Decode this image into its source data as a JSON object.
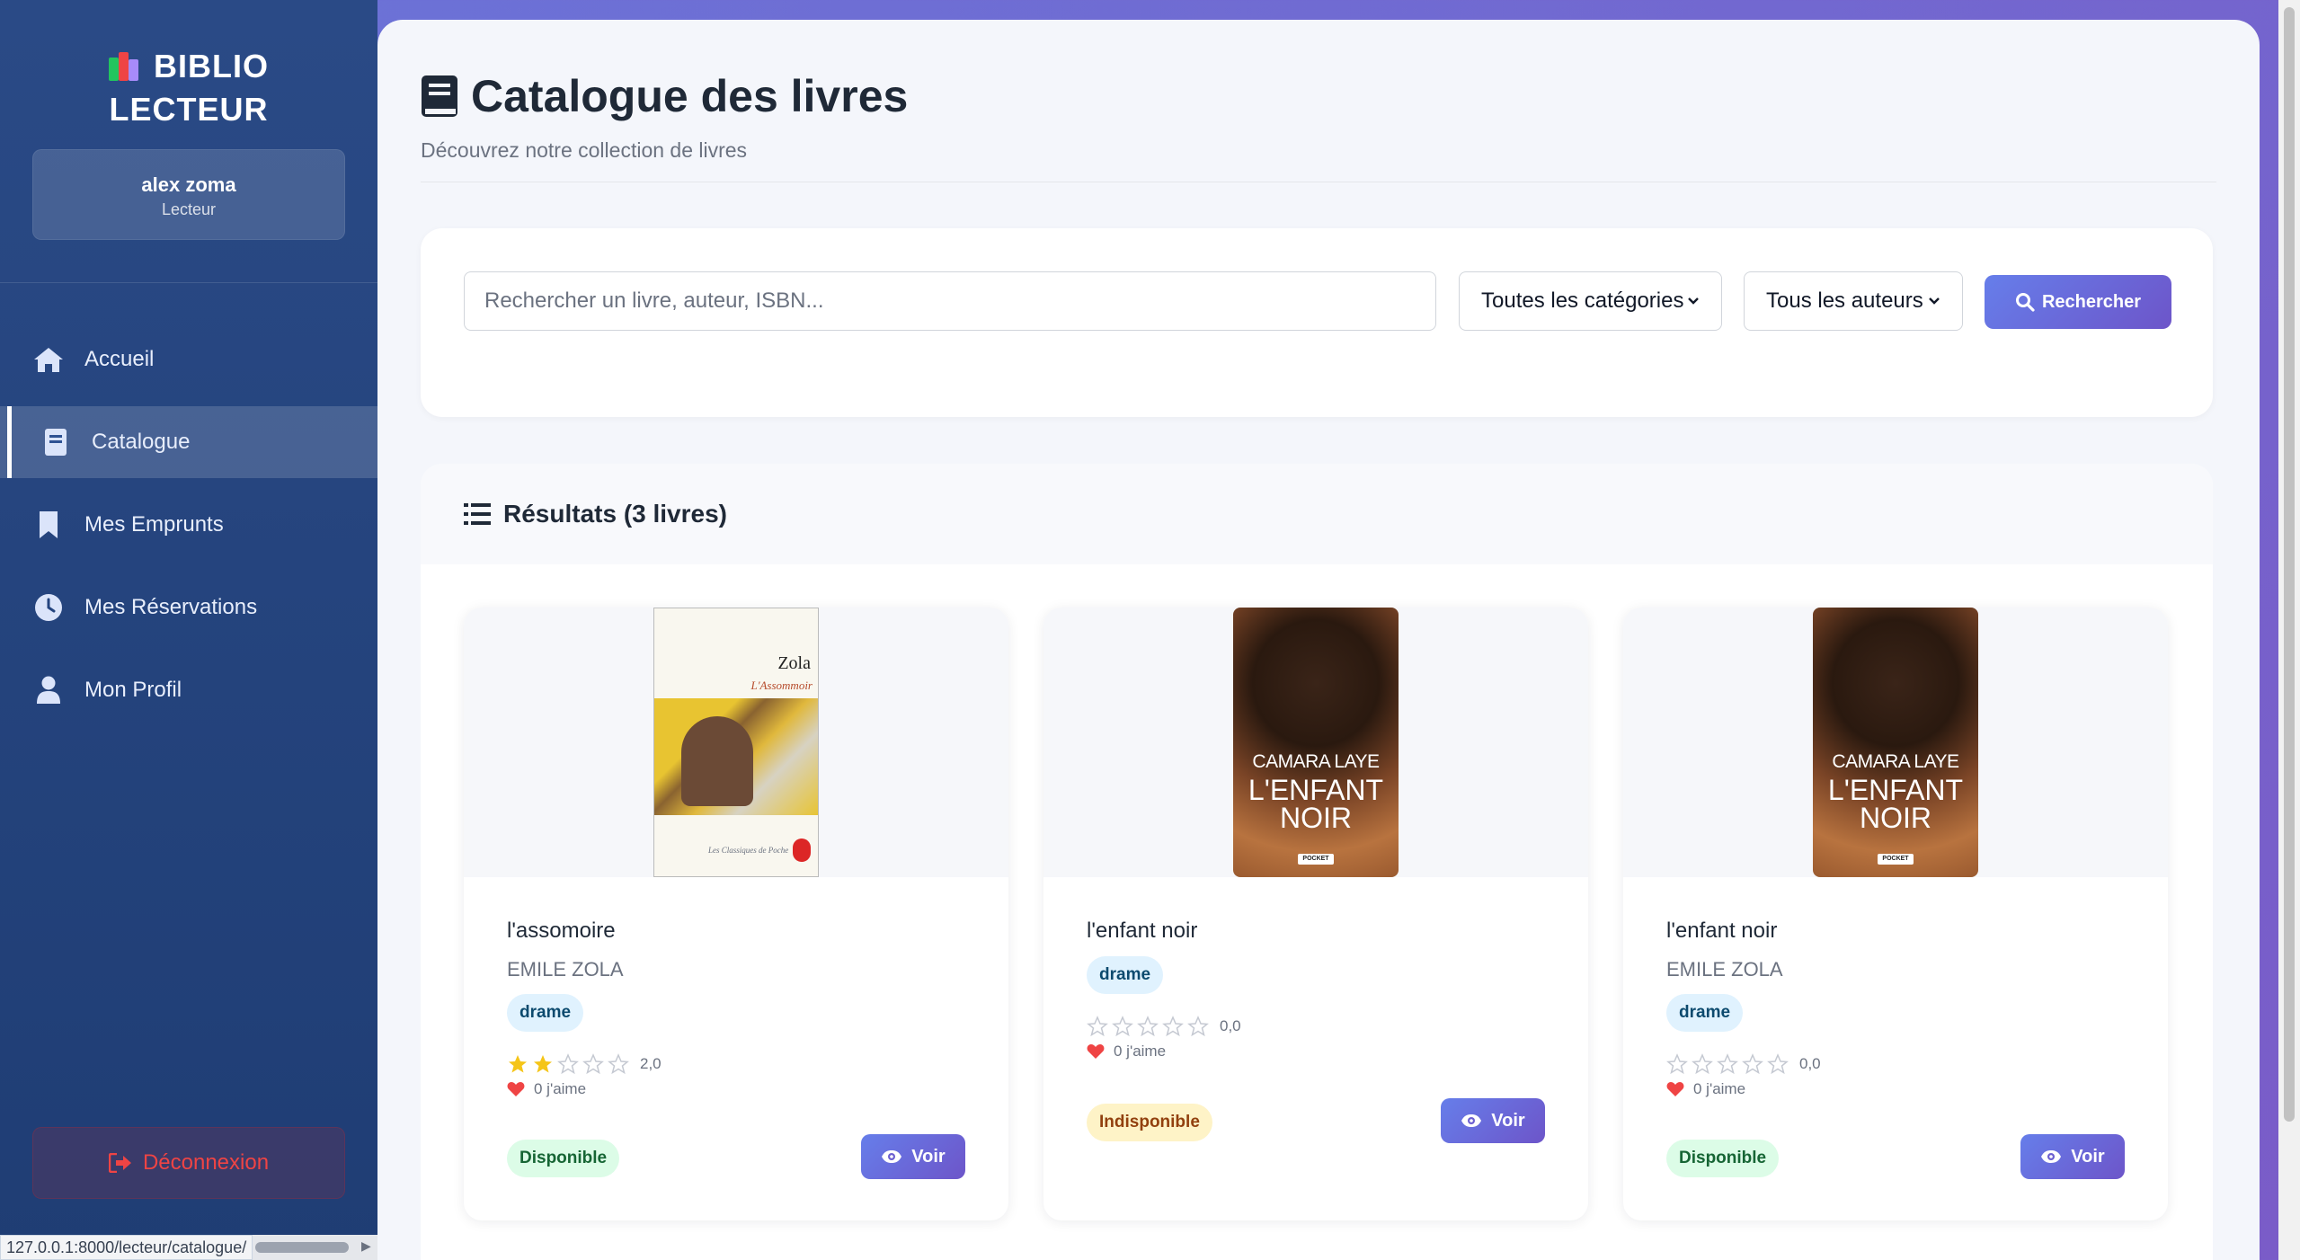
{
  "brand": {
    "line1": "BIBLIO",
    "line2": "LECTEUR"
  },
  "user": {
    "name": "alex zoma",
    "role": "Lecteur"
  },
  "nav": [
    {
      "label": "Accueil",
      "icon": "home-icon",
      "active": false
    },
    {
      "label": "Catalogue",
      "icon": "book-icon",
      "active": true
    },
    {
      "label": "Mes Emprunts",
      "icon": "bookmark-icon",
      "active": false
    },
    {
      "label": "Mes Réservations",
      "icon": "clock-icon",
      "active": false
    },
    {
      "label": "Mon Profil",
      "icon": "user-icon",
      "active": false
    }
  ],
  "logout": {
    "label": "Déconnexion"
  },
  "status_url": "127.0.0.1:8000/lecteur/catalogue/",
  "page": {
    "title": "Catalogue des livres",
    "subtitle": "Découvrez notre collection de livres"
  },
  "search": {
    "placeholder": "Rechercher un livre, auteur, ISBN...",
    "category_selected": "Toutes les catégories",
    "author_selected": "Tous les auteurs",
    "button": "Rechercher"
  },
  "results": {
    "header": "Résultats (3 livres)",
    "books": [
      {
        "title": "l'assomoire",
        "author": "EMILE ZOLA",
        "tag": "drame",
        "rating": 2,
        "rating_label": "2,0",
        "likes": "0 j'aime",
        "status": "Disponible",
        "available": true,
        "cover": {
          "author": "Zola",
          "title": "L'Assommoir",
          "footer": "Les Classiques de Poche"
        },
        "action": "Voir"
      },
      {
        "title": "l'enfant noir",
        "author": "",
        "tag": "drame",
        "rating": 0,
        "rating_label": "0,0",
        "likes": "0 j'aime",
        "status": "Indisponible",
        "available": false,
        "cover": {
          "author": "CAMARA LAYE",
          "title_1": "L'ENFANT",
          "title_2": "NOIR",
          "publisher": "POCKET"
        },
        "action": "Voir"
      },
      {
        "title": "l'enfant noir",
        "author": "EMILE ZOLA",
        "tag": "drame",
        "rating": 0,
        "rating_label": "0,0",
        "likes": "0 j'aime",
        "status": "Disponible",
        "available": true,
        "cover": {
          "author": "CAMARA LAYE",
          "title_1": "L'ENFANT",
          "title_2": "NOIR",
          "publisher": "POCKET"
        },
        "action": "Voir"
      }
    ]
  },
  "colors": {
    "sidebar": "#2a4a86",
    "accent": "#667eea",
    "danger": "#ef4444",
    "star": "#f5c518",
    "heart": "#ef4444"
  }
}
